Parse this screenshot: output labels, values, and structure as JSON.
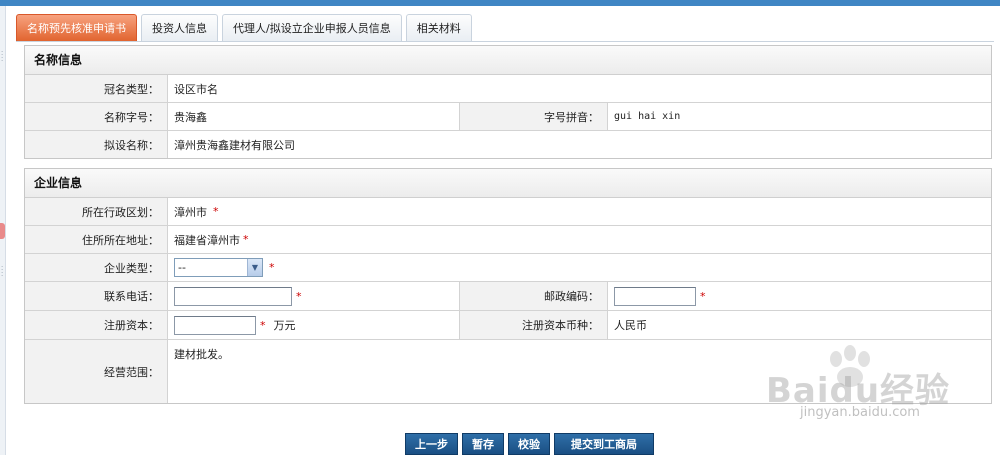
{
  "tabs": [
    {
      "label": "名称预先核准申请书",
      "active": true
    },
    {
      "label": "投资人信息",
      "active": false
    },
    {
      "label": "代理人/拟设立企业申报人员信息",
      "active": false
    },
    {
      "label": "相关材料",
      "active": false
    }
  ],
  "name_info": {
    "title": "名称信息",
    "crown_type_label": "冠名类型：",
    "crown_type_value": "设区市名",
    "trade_name_label": "名称字号：",
    "trade_name_value": "贵海鑫",
    "pinyin_label": "字号拼音：",
    "pinyin_value": "gui hai xin",
    "proposed_name_label": "拟设名称：",
    "proposed_name_value": "漳州贵海鑫建材有限公司"
  },
  "company_info": {
    "title": "企业信息",
    "district_label": "所在行政区划：",
    "district_value": "漳州市",
    "address_label": "住所所在地址：",
    "address_value": "福建省漳州市",
    "type_label": "企业类型：",
    "type_value": "--",
    "phone_label": "联系电话：",
    "phone_value": "",
    "postcode_label": "邮政编码：",
    "postcode_value": "",
    "capital_label": "注册资本：",
    "capital_value": "",
    "capital_unit": "万元",
    "currency_label": "注册资本币种：",
    "currency_value": "人民币",
    "scope_label": "经营范围：",
    "scope_value": "建材批发。",
    "required_mark": "*"
  },
  "buttons": {
    "prev": "上一步",
    "save": "暂存",
    "check": "校验",
    "submit": "提交到工商局"
  },
  "watermark": {
    "logo": "Baidu经验",
    "url": "jingyan.baidu.com"
  },
  "colors": {
    "active_tab": "#e1642f",
    "button": "#1a4f83",
    "top_bar": "#3f86c4",
    "required": "#cc0000"
  }
}
